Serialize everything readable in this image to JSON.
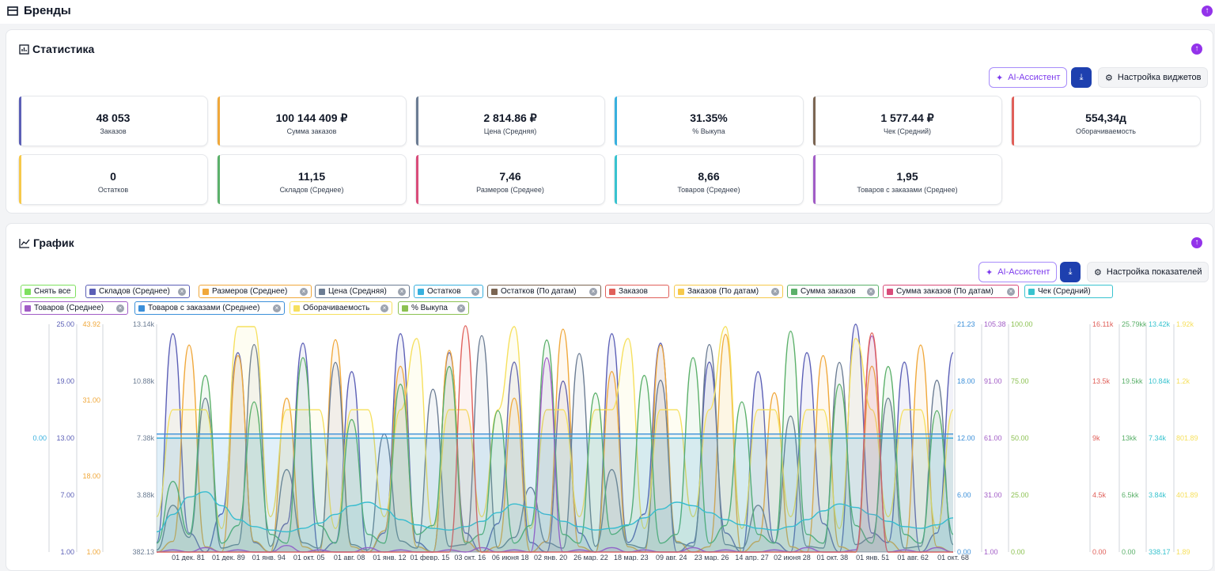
{
  "brands": {
    "title": "Бренды"
  },
  "statistics": {
    "title": "Статистика",
    "ai_label": "AI-Ассистент",
    "settings_label": "Настройка виджетов",
    "cards": [
      {
        "value": "48 053",
        "label": "Заказов",
        "color": "#5b5fb6"
      },
      {
        "value": "100 144 409 ₽",
        "label": "Сумма заказов",
        "color": "#f0a83b"
      },
      {
        "value": "2 814.86 ₽",
        "label": "Цена (Средняя)",
        "color": "#6b7c93"
      },
      {
        "value": "31.35%",
        "label": "% Выкупа",
        "color": "#38b0de"
      },
      {
        "value": "1 577.44 ₽",
        "label": "Чек (Средний)",
        "color": "#7b6552"
      },
      {
        "value": "554,34д",
        "label": "Оборачиваемость",
        "color": "#e0605a"
      },
      {
        "value": "0",
        "label": "Остатков",
        "color": "#f6c94a"
      },
      {
        "value": "11,15",
        "label": "Складов (Среднее)",
        "color": "#5bb06a"
      },
      {
        "value": "7,46",
        "label": "Размеров (Среднее)",
        "color": "#d94c7a"
      },
      {
        "value": "8,66",
        "label": "Товаров (Среднее)",
        "color": "#38c3cf"
      },
      {
        "value": "1,95",
        "label": "Товаров с заказами (Среднее)",
        "color": "#a15cc6"
      }
    ]
  },
  "chart_section": {
    "title": "График",
    "ai_label": "AI-Ассистент",
    "settings_label": "Настройка показателей",
    "legend": [
      {
        "label": "Снять все",
        "color": "#7ee05e",
        "closable": false
      },
      {
        "label": "Складов (Среднее)",
        "color": "#5b5fb6",
        "closable": true
      },
      {
        "label": "Размеров (Среднее)",
        "color": "#f0a83b",
        "closable": true
      },
      {
        "label": "Цена (Средняя)",
        "color": "#6b7c93",
        "closable": true
      },
      {
        "label": "Остатков",
        "color": "#38b0de",
        "closable": true
      },
      {
        "label": "Остатков (По датам)",
        "color": "#7b6552",
        "closable": true
      },
      {
        "label": "Заказов",
        "color": "#e0605a",
        "closable": false
      },
      {
        "label": "Заказов (По датам)",
        "color": "#f6c94a",
        "closable": true
      },
      {
        "label": "Сумма заказов",
        "color": "#5bb06a",
        "closable": true
      },
      {
        "label": "Сумма заказов (По датам)",
        "color": "#d94c7a",
        "closable": true
      },
      {
        "label": "Чек (Средний)",
        "color": "#38c3cf",
        "closable": false
      },
      {
        "label": "Товаров (Среднее)",
        "color": "#a15cc6",
        "closable": true
      },
      {
        "label": "Товаров с заказами (Среднее)",
        "color": "#3b8fd9",
        "closable": true
      },
      {
        "label": "Оборачиваемость",
        "color": "#f6e05e",
        "closable": true
      },
      {
        "label": "% Выкупа",
        "color": "#8cc152",
        "closable": true
      }
    ]
  },
  "chart_data": {
    "type": "line",
    "left_axes": [
      {
        "ticks": [
          "0.00"
        ],
        "color": "#38b0de"
      },
      {
        "ticks": [
          "25.00",
          "19.00",
          "13.00",
          "7.00",
          "1.00"
        ],
        "color": "#5b5fb6"
      },
      {
        "ticks": [
          "43.92",
          "31.00",
          "18.00",
          "1.00"
        ],
        "color": "#f0a83b"
      },
      {
        "ticks": [
          "13.14k",
          "10.88k",
          "7.38k",
          "3.88k",
          "382.13"
        ],
        "color": "#6b7c93"
      }
    ],
    "right_axes": [
      {
        "ticks": [
          "21.23",
          "18.00",
          "12.00",
          "6.00",
          "0.00"
        ],
        "color": "#3b8fd9"
      },
      {
        "ticks": [
          "105.38",
          "91.00",
          "61.00",
          "31.00",
          "1.00"
        ],
        "color": "#a15cc6"
      },
      {
        "ticks": [
          "100.00",
          "75.00",
          "50.00",
          "25.00",
          "0.00"
        ],
        "color": "#8cc152"
      },
      {
        "ticks": [
          "16.11k",
          "13.5k",
          "9k",
          "4.5k",
          "0.00"
        ],
        "color": "#e0605a"
      },
      {
        "ticks": [
          "25.79kk",
          "19.5kk",
          "13kk",
          "6.5kk",
          "0.00"
        ],
        "color": "#5bb06a"
      },
      {
        "ticks": [
          "13.42k",
          "10.84k",
          "7.34k",
          "3.84k",
          "338.17"
        ],
        "color": "#38c3cf"
      },
      {
        "ticks": [
          "1.92k",
          "1.2k",
          "801.89",
          "401.89",
          "1.89"
        ],
        "color": "#f6e05e"
      }
    ],
    "x_ticks": [
      "01 дек. 81",
      "01 дек. 89",
      "01 янв. 94",
      "01 окт. 05",
      "01 авг. 08",
      "01 янв. 12",
      "01 февр. 15",
      "03 окт. 16",
      "06 июня 18",
      "02 янв. 20",
      "26 мар. 22",
      "18 мар. 23",
      "09 авг. 24",
      "23 мар. 26",
      "14 апр. 27",
      "02 июня 28",
      "01 окт. 38",
      "01 янв. 51",
      "01 авг. 62",
      "01 окт. 68"
    ],
    "series": [
      {
        "name": "Складов (Среднее)",
        "color": "#5b5fb6",
        "values": [
          2,
          24,
          3,
          1,
          5,
          22,
          2,
          1,
          4,
          23,
          1,
          2,
          20,
          1,
          3,
          24,
          2,
          1,
          22,
          3,
          1,
          4,
          21,
          2,
          1,
          19,
          3,
          1,
          24,
          2,
          5,
          23,
          1,
          2,
          21,
          3,
          1,
          20,
          2,
          1,
          22,
          4,
          1,
          25,
          3,
          2,
          21,
          1,
          3,
          22
        ]
      },
      {
        "name": "Размеров (Среднее)",
        "color": "#f0a83b",
        "values": [
          1,
          3,
          40,
          2,
          1,
          38,
          3,
          1,
          30,
          2,
          1,
          41,
          2,
          1,
          5,
          36,
          2,
          1,
          39,
          3,
          1,
          2,
          30,
          1,
          3,
          43,
          2,
          1,
          35,
          2,
          1,
          40,
          3,
          1,
          2,
          42,
          1,
          3,
          31,
          2,
          1,
          38,
          2,
          1,
          36,
          3,
          1,
          40,
          2,
          1
        ]
      },
      {
        "name": "Цена (Средняя)",
        "color": "#6b7c93",
        "values": [
          500,
          3000,
          1200,
          9000,
          600,
          800,
          12000,
          700,
          5000,
          900,
          600,
          11000,
          800,
          500,
          7000,
          1000,
          600,
          9500,
          700,
          800,
          12500,
          600,
          1200,
          4000,
          900,
          600,
          11500,
          700,
          5000,
          800,
          600,
          10000,
          900,
          700,
          12000,
          800,
          600,
          3000,
          900,
          8000,
          700,
          600,
          11000,
          800,
          1200,
          9000,
          600,
          700,
          10000,
          800
        ]
      },
      {
        "name": "Оборачиваемость",
        "color": "#f6e05e",
        "values": [
          300,
          1200,
          1200,
          1200,
          200,
          1900,
          1900,
          300,
          1200,
          1200,
          1200,
          200,
          1200,
          1200,
          300,
          1200,
          1800,
          200,
          1200,
          1200,
          300,
          1200,
          1900,
          200,
          1200,
          1200,
          300,
          1200,
          1200,
          1800,
          200,
          1200,
          1200,
          300,
          1200,
          1900,
          200,
          1200,
          1200,
          300,
          1200,
          1200,
          200,
          1800,
          1200,
          300,
          1200,
          1200,
          200,
          1200
        ]
      },
      {
        "name": "Сумма заказов",
        "color": "#5bb06a",
        "values": [
          1,
          8,
          2,
          20,
          1,
          3,
          17,
          2,
          1,
          22,
          3,
          1,
          15,
          2,
          1,
          19,
          2,
          3,
          21,
          1,
          2,
          16,
          1,
          3,
          24,
          2,
          1,
          18,
          2,
          3,
          20,
          1,
          2,
          22,
          1,
          3,
          17,
          2,
          1,
          25,
          2,
          1,
          19,
          3,
          1,
          21,
          2,
          1,
          16,
          2
        ]
      },
      {
        "name": "Чек (Средний)",
        "color": "#38c3cf",
        "values": [
          1500,
          2500,
          3500,
          3800,
          3000,
          2200,
          1800,
          1600,
          1500,
          1700,
          2000,
          2500,
          3000,
          3200,
          2800,
          2200,
          1900,
          1700,
          1600,
          1800,
          2100,
          2600,
          3100,
          2900,
          2500,
          2100,
          1800,
          1600,
          1700,
          1900,
          2300,
          2800,
          3200,
          3000,
          2600,
          2200,
          1900,
          1700,
          1600,
          1800,
          2200,
          2700,
          3100,
          2900,
          2500,
          2100,
          1800,
          1700,
          1900,
          2300
        ]
      },
      {
        "name": "Товаров (Среднее)",
        "color": "#a15cc6",
        "values": [
          1,
          2,
          1,
          3,
          1,
          2,
          1,
          1,
          4,
          1,
          2,
          1,
          1,
          3,
          1,
          2,
          1,
          1,
          2,
          1,
          3,
          1,
          2,
          1,
          90,
          1,
          2,
          1,
          3,
          1,
          2,
          1,
          1,
          3,
          1,
          2,
          1,
          1,
          2,
          1,
          3,
          1,
          1,
          2,
          100,
          1,
          2,
          1,
          3,
          1
        ]
      },
      {
        "name": "Заказов",
        "color": "#e0605a",
        "values": [
          0,
          0,
          0,
          0,
          0,
          0,
          0,
          0,
          0,
          0,
          0,
          0,
          0,
          0,
          0,
          0,
          0,
          0,
          0,
          16000,
          0,
          0,
          0,
          0,
          0,
          0,
          0,
          0,
          0,
          0,
          0,
          0,
          0,
          0,
          0,
          0,
          0,
          0,
          0,
          0,
          0,
          0,
          0,
          0,
          15500,
          0,
          0,
          0,
          0,
          0
        ]
      },
      {
        "name": "Остатков",
        "color": "#38b0de",
        "values": [
          0,
          0,
          0,
          0,
          0,
          0,
          0,
          0,
          0,
          0,
          0,
          0,
          0,
          0,
          0,
          0,
          0,
          0,
          0,
          0,
          0,
          0,
          0,
          0,
          0,
          0,
          0,
          0,
          0,
          0,
          0,
          0,
          0,
          0,
          0,
          0,
          0,
          0,
          0,
          0,
          0,
          0,
          0,
          0,
          0,
          0,
          0,
          0,
          0,
          0
        ]
      },
      {
        "name": "Товаров с заказами (Среднее)",
        "color": "#3b8fd9",
        "values": [
          11,
          11,
          11,
          11,
          11,
          11,
          11,
          11,
          11,
          11,
          11,
          11,
          11,
          11,
          11,
          11,
          11,
          11,
          11,
          11,
          11,
          11,
          11,
          11,
          11,
          11,
          11,
          11,
          11,
          11,
          11,
          11,
          11,
          11,
          11,
          11,
          11,
          11,
          11,
          11,
          11,
          11,
          11,
          11,
          11,
          11,
          11,
          11,
          11,
          11
        ]
      }
    ]
  }
}
